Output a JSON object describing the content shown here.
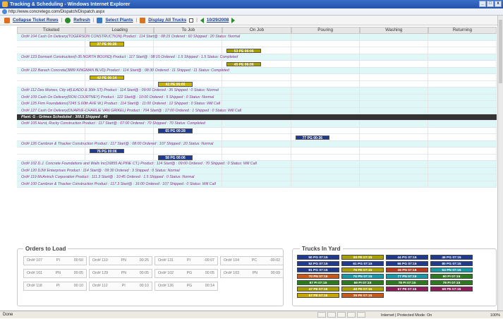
{
  "window": {
    "title": "Tracking & Scheduling - Windows Internet Explorer",
    "url": "http://www.concretego.com/Dispatch/Dispatch.aspx"
  },
  "toolbar": {
    "collapse_label": "Collapse Ticket Rows",
    "refresh_label": "Refresh",
    "select_plants_label": "Select Plants",
    "display_trucks_label": "Display All Trucks",
    "date": "10/29/2008"
  },
  "columns": [
    "Ticketed",
    "Loading",
    "To Job",
    "On Job",
    "Pouring",
    "Washing",
    "Returning"
  ],
  "rows": [
    {
      "type": "ticket",
      "text": "Ord# 104    Cash On Delivery(TOGERSON CONSTRUCTION)  Product : 114      Start@ : 08:15    Ordered : 60      Shipped : 20           Status: Normal"
    },
    {
      "type": "truck",
      "bar": "37 PE 06:26",
      "color": "yellow",
      "col": 1
    },
    {
      "type": "truck",
      "bar": "53 PE 06:06",
      "color": "olive",
      "col": 3
    },
    {
      "type": "ticket",
      "text": "Ord# 123    Dormark Construction(I-35 NORTH BOUND)  Product : 117      Start@ : 08:15    Ordered : 1.5      Shipped : 1.5          Status: Completed"
    },
    {
      "type": "truck",
      "bar": "45 PE 06:06",
      "color": "olive",
      "col": 3
    },
    {
      "type": "ticket",
      "text": "Ord# 122    Barach Concrete(3889 KINGMAN BLVD)  Product : 114      Start@ : 08:30    Ordered : 11      Shipped : 11           Status: Completed"
    },
    {
      "type": "truck",
      "bar": "42 PE 06:14",
      "color": "yellow",
      "col": 1
    },
    {
      "type": "truck",
      "bar": "43 PE 06:00",
      "color": "yellow",
      "col": 2
    },
    {
      "type": "ticket",
      "text": "Ord# 112    Des Moines, City of(LEADO & 30th ST)  Product : 114      Start@ : 09:00    Ordered : 35      Shipped : 0           Status: Normal"
    },
    {
      "type": "ticket",
      "text": "Ord# 109    Cash On Delivery(RON COURTNEY)  Product : 122      Start@ : 10:00    Ordered : 5      Shipped : 0           Status: Normal"
    },
    {
      "type": "ticket",
      "text": "Ord# 125    Firm Foundations(7245 S.60th AVE W.)  Product : 114      Start@ : 11:00    Ordered : 12      Shipped : 0           Status: Will Call"
    },
    {
      "type": "ticket",
      "text": "Ord# 127    Cash On Delivery(DUARVE-CHARLIE VAN GRIKEL)  Product : 704      Start@ : 17:00    Ordered : 1      Shipped : 0           Status: Will Call"
    },
    {
      "type": "plant",
      "text": "Plant: G - Grimes     Scheduled : 308.5    Shipped : 40"
    },
    {
      "type": "ticket",
      "text": "Ord# 105    Hurst, Rocky Construction  Product : 117      Start@ : 07:00    Ordered : 70      Shipped : 70           Status: Completed"
    },
    {
      "type": "truck",
      "bar": "65 PG 00:28",
      "color": "navy",
      "col": 2
    },
    {
      "type": "truck",
      "bar": "77 PG 00:36",
      "color": "navy",
      "col": 4
    },
    {
      "type": "ticket",
      "text": "Ord# 126    Cambron & Thacker Construction  Product : 117      Start@ : 08:00    Ordered : 107      Shipped : 20           Status: Normal"
    },
    {
      "type": "truck",
      "bar": "76 PG 00:06",
      "color": "navy",
      "col": 1
    },
    {
      "type": "truck",
      "bar": "58 PG 00:06",
      "color": "navy",
      "col": 2
    },
    {
      "type": "ticket",
      "text": "Ord# 102    D.J. Concrete Foundations and Walls Inc(16855 ALPINE CT.)  Product : 114      Start@ : 09:00    Ordered : 70      Shipped : 0           Status: Will Call"
    },
    {
      "type": "ticket",
      "text": "Ord# 120    DJW Enterprises          Product : 114      Start@ : 09:30    Ordered : 3      Shipped : 0           Status: Normal"
    },
    {
      "type": "ticket",
      "text": "Ord# 119    McAninch Corporation     Product : 111.3      Start@ : 10:45    Ordered : 1.5      Shipped : 0           Status: Normal"
    },
    {
      "type": "ticket",
      "text": "Ord# 100    Cambron & Thacker Construction  Product : 117.3      Start@ : 16:00    Ordered : 107      Shipped : 0           Status: Will Call"
    }
  ],
  "orders_to_load": {
    "title": "Orders to Load",
    "items": [
      {
        "ord": "Ord# 107",
        "plant": "PI",
        "time": "00:50"
      },
      {
        "ord": "Ord# 110",
        "plant": "PN",
        "time": "00:25"
      },
      {
        "ord": "Ord# 131",
        "plant": "PI",
        "time": "-00:07"
      },
      {
        "ord": "Ord# 104",
        "plant": "PC",
        "time": "-00:02"
      },
      {
        "ord": "Ord# 101",
        "plant": "PN",
        "time": "00:05"
      },
      {
        "ord": "Ord# 129",
        "plant": "PN",
        "time": "00:05"
      },
      {
        "ord": "Ord# 102",
        "plant": "PG",
        "time": "00:05"
      },
      {
        "ord": "Ord# 103",
        "plant": "PN",
        "time": "00:09"
      },
      {
        "ord": "Ord# 118",
        "plant": "PI",
        "time": "00:10"
      },
      {
        "ord": "Ord# 112",
        "plant": "PI",
        "time": "00:10"
      },
      {
        "ord": "Ord# 126",
        "plant": "PG",
        "time": "00:14"
      }
    ]
  },
  "trucks_in_yard": {
    "title": "Trucks In Yard",
    "items": [
      {
        "label": "50 PG 07:15",
        "color": "#1f3a8e"
      },
      {
        "label": "59 PE 07:15",
        "color": "#a8a000"
      },
      {
        "label": "44 PG 07:15",
        "color": "#1f3a8e"
      },
      {
        "label": "46 PG 07:15",
        "color": "#1f3a8e"
      },
      {
        "label": "52 PG 07:15",
        "color": "#1f3a8e"
      },
      {
        "label": "61 PG 07:15",
        "color": "#1f3a8e"
      },
      {
        "label": "66 PG 07:15",
        "color": "#1f3a8e"
      },
      {
        "label": "80 PG 07:15",
        "color": "#1f3a8e"
      },
      {
        "label": "81 PG 07:15",
        "color": "#1f3a8e"
      },
      {
        "label": "76 PE 07:15",
        "color": "#a8a000"
      },
      {
        "label": "45 PN 07:15",
        "color": "#b83a1f"
      },
      {
        "label": "64 PN 07:15",
        "color": "#1a9aa8"
      },
      {
        "label": "70 PN 07:15",
        "color": "#c8591a"
      },
      {
        "label": "76 PN 07:15",
        "color": "#1a9aa8"
      },
      {
        "label": "77 PN 07:15",
        "color": "#1a9aa8"
      },
      {
        "label": "60 PI 07:15",
        "color": "#2d7a1f"
      },
      {
        "label": "67 PI 07:15",
        "color": "#2d7a1f"
      },
      {
        "label": "69 PI 07:15",
        "color": "#2d7a1f"
      },
      {
        "label": "78 PI 07:15",
        "color": "#2d7a1f"
      },
      {
        "label": "79 PI 07:15",
        "color": "#2d7a1f"
      },
      {
        "label": "47 PE 07:15",
        "color": "#a8a000"
      },
      {
        "label": "48 PE 07:15",
        "color": "#a8a000"
      },
      {
        "label": "67 PE 07:15",
        "color": "#8a1f5a"
      },
      {
        "label": "68 PE 07:15",
        "color": "#8a1f5a"
      },
      {
        "label": "57 PE 07:15",
        "color": "#c8a800"
      },
      {
        "label": "39 PE 07:15",
        "color": "#c8591a"
      }
    ]
  },
  "status": {
    "left": "Done",
    "zone": "Internet | Protected Mode: On",
    "zoom": "100%"
  }
}
